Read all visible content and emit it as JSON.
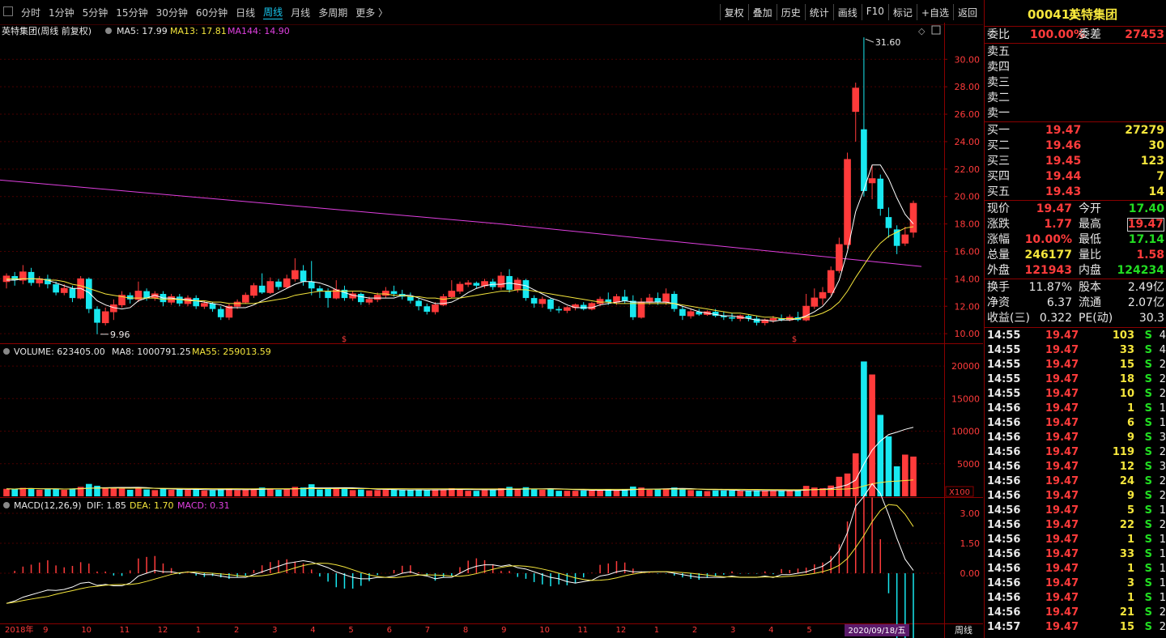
{
  "toolbar": {
    "periods": [
      "分时",
      "1分钟",
      "5分钟",
      "15分钟",
      "30分钟",
      "60分钟",
      "日线",
      "周线",
      "月线",
      "多周期",
      "更多 〉"
    ],
    "active_period": "周线",
    "tools": [
      "复权",
      "叠加",
      "历史",
      "统计",
      "画线",
      "F10",
      "标记",
      "+自选",
      "返回"
    ]
  },
  "chart_header": {
    "title": "英特集团(周线 前复权)",
    "ma5": "MA5: 17.99",
    "ma13": "MA13: 17.81",
    "ma144": "MA144: 14.90",
    "volume": "VOLUME: 623405.00",
    "ma8": "MA8: 1000791.25",
    "ma55": "MA55: 259013.59",
    "macd_name": "MACD(12,26,9)",
    "dif": "DIF: 1.85",
    "dea": "DEA: 1.70",
    "macd": "MACD: 0.31"
  },
  "colors": {
    "up": "#ff3b3b",
    "down": "#18e8f0",
    "ma5": "#ffffff",
    "ma13": "#f5e63c",
    "ma144": "#e040e0"
  },
  "chart_data": [
    {
      "type": "candlestick",
      "title": "英特集团(周线 前复权)",
      "price_ticks": [
        "30.00",
        "28.00",
        "26.00",
        "24.00",
        "22.00",
        "20.00",
        "18.00",
        "16.00",
        "14.00",
        "12.00",
        "10.00"
      ],
      "ylim": [
        9.3,
        32.2
      ],
      "high_label": "31.60",
      "low_label": "9.96",
      "candles": [
        [
          13.8,
          14.2,
          13.3,
          14.4
        ],
        [
          14.2,
          13.9,
          13.5,
          14.5
        ],
        [
          13.9,
          14.5,
          13.6,
          15.0
        ],
        [
          14.5,
          13.7,
          13.5,
          14.8
        ],
        [
          13.7,
          14.0,
          13.4,
          14.2
        ],
        [
          14.0,
          13.6,
          13.3,
          14.3
        ],
        [
          13.6,
          13.0,
          12.8,
          13.8
        ],
        [
          13.0,
          13.3,
          12.8,
          13.6
        ],
        [
          13.3,
          12.6,
          12.3,
          13.5
        ],
        [
          12.6,
          14.0,
          12.5,
          14.2
        ],
        [
          14.0,
          11.8,
          11.5,
          14.1
        ],
        [
          11.8,
          10.8,
          9.96,
          12.0
        ],
        [
          10.8,
          11.6,
          10.6,
          11.9
        ],
        [
          11.6,
          12.1,
          11.0,
          12.5
        ],
        [
          12.1,
          12.8,
          11.9,
          13.1
        ],
        [
          12.8,
          12.5,
          12.2,
          13.0
        ],
        [
          12.5,
          13.1,
          12.3,
          13.8
        ],
        [
          13.1,
          12.6,
          12.4,
          13.3
        ],
        [
          12.6,
          12.9,
          12.4,
          13.1
        ],
        [
          12.9,
          12.3,
          12.0,
          13.1
        ],
        [
          12.3,
          12.7,
          12.1,
          12.9
        ],
        [
          12.7,
          12.2,
          12.0,
          12.9
        ],
        [
          12.2,
          12.6,
          12.0,
          12.8
        ],
        [
          12.6,
          12.0,
          11.8,
          12.8
        ],
        [
          12.0,
          12.2,
          11.8,
          12.4
        ],
        [
          12.2,
          11.8,
          11.6,
          12.3
        ],
        [
          11.8,
          11.2,
          11.0,
          12.0
        ],
        [
          11.2,
          12.0,
          11.0,
          12.2
        ],
        [
          12.0,
          12.3,
          11.8,
          12.5
        ],
        [
          12.3,
          12.8,
          12.2,
          13.0
        ],
        [
          12.8,
          13.5,
          12.6,
          13.7
        ],
        [
          13.5,
          13.0,
          12.9,
          14.4
        ],
        [
          13.0,
          13.8,
          12.9,
          14.1
        ],
        [
          13.8,
          13.4,
          13.2,
          14.0
        ],
        [
          13.4,
          14.0,
          13.3,
          14.3
        ],
        [
          14.0,
          14.6,
          13.8,
          15.5
        ],
        [
          14.6,
          13.8,
          13.5,
          15.0
        ],
        [
          13.8,
          13.3,
          12.8,
          15.3
        ],
        [
          13.3,
          13.1,
          12.6,
          13.5
        ],
        [
          13.1,
          12.6,
          11.9,
          13.3
        ],
        [
          12.6,
          13.2,
          12.5,
          13.9
        ],
        [
          13.2,
          12.6,
          12.4,
          13.5
        ],
        [
          12.6,
          12.9,
          12.4,
          13.1
        ],
        [
          12.9,
          12.3,
          12.1,
          13.0
        ],
        [
          12.3,
          12.5,
          12.1,
          12.7
        ],
        [
          12.5,
          12.8,
          12.3,
          13.0
        ],
        [
          12.8,
          13.1,
          12.6,
          13.4
        ],
        [
          13.1,
          12.9,
          12.7,
          13.5
        ],
        [
          12.9,
          12.7,
          12.5,
          13.2
        ],
        [
          12.7,
          12.4,
          12.2,
          13.0
        ],
        [
          12.4,
          12.0,
          11.7,
          12.6
        ],
        [
          12.0,
          11.6,
          11.4,
          12.2
        ],
        [
          11.6,
          12.1,
          11.4,
          12.3
        ],
        [
          12.1,
          12.7,
          12.0,
          12.9
        ],
        [
          12.7,
          13.1,
          12.6,
          13.9
        ],
        [
          13.1,
          13.6,
          12.9,
          13.8
        ],
        [
          13.6,
          13.7,
          13.4,
          13.9
        ],
        [
          13.7,
          13.5,
          13.3,
          13.8
        ],
        [
          13.5,
          13.8,
          13.3,
          14.0
        ],
        [
          13.8,
          13.4,
          13.2,
          14.0
        ],
        [
          13.4,
          14.2,
          13.2,
          14.5
        ],
        [
          14.2,
          13.2,
          13.0,
          14.7
        ],
        [
          13.2,
          13.9,
          13.0,
          14.1
        ],
        [
          13.9,
          12.6,
          12.4,
          14.0
        ],
        [
          12.6,
          12.2,
          11.9,
          12.8
        ],
        [
          12.2,
          12.5,
          11.9,
          12.7
        ],
        [
          12.5,
          11.8,
          11.6,
          12.6
        ],
        [
          11.8,
          11.7,
          11.5,
          12.0
        ],
        [
          11.7,
          11.9,
          11.5,
          12.0
        ],
        [
          11.9,
          12.1,
          11.7,
          12.2
        ],
        [
          12.1,
          11.8,
          11.7,
          12.3
        ],
        [
          11.8,
          12.2,
          11.7,
          12.3
        ],
        [
          12.2,
          12.5,
          12.0,
          12.7
        ],
        [
          12.5,
          12.3,
          12.1,
          13.0
        ],
        [
          12.3,
          12.7,
          12.1,
          12.9
        ],
        [
          12.7,
          12.4,
          12.2,
          13.2
        ],
        [
          12.4,
          11.2,
          11.0,
          12.8
        ],
        [
          11.2,
          12.3,
          11.1,
          12.6
        ],
        [
          12.3,
          12.6,
          12.1,
          12.9
        ],
        [
          12.6,
          12.3,
          12.1,
          13.0
        ],
        [
          12.3,
          12.9,
          12.1,
          13.3
        ],
        [
          12.9,
          11.8,
          11.6,
          13.1
        ],
        [
          11.8,
          11.3,
          11.0,
          12.0
        ],
        [
          11.3,
          11.6,
          11.1,
          11.8
        ],
        [
          11.6,
          11.4,
          11.3,
          11.8
        ],
        [
          11.4,
          11.6,
          11.3,
          11.7
        ],
        [
          11.6,
          11.3,
          11.2,
          11.8
        ],
        [
          11.3,
          11.2,
          11.0,
          11.6
        ],
        [
          11.2,
          11.1,
          10.9,
          11.5
        ],
        [
          11.1,
          11.3,
          10.9,
          11.4
        ],
        [
          11.3,
          11.1,
          10.9,
          11.4
        ],
        [
          11.1,
          10.8,
          10.6,
          11.3
        ],
        [
          10.8,
          11.0,
          10.6,
          11.1
        ],
        [
          11.0,
          11.1,
          10.8,
          11.3
        ],
        [
          11.1,
          11.0,
          10.9,
          11.4
        ],
        [
          11.0,
          11.2,
          10.9,
          11.4
        ],
        [
          11.2,
          11.0,
          10.9,
          11.6
        ],
        [
          11.0,
          12.0,
          10.9,
          12.9
        ],
        [
          12.0,
          12.6,
          11.8,
          13.3
        ],
        [
          12.6,
          13.0,
          12.1,
          13.4
        ],
        [
          13.0,
          14.6,
          12.8,
          14.9
        ],
        [
          14.6,
          16.5,
          14.4,
          17.0
        ],
        [
          16.5,
          22.7,
          16.2,
          23.2
        ],
        [
          26.2,
          27.9,
          24.0,
          28.3
        ],
        [
          24.9,
          20.4,
          20.0,
          31.6
        ],
        [
          21.0,
          21.3,
          19.8,
          22.3
        ],
        [
          21.3,
          19.1,
          18.6,
          21.6
        ],
        [
          18.5,
          17.7,
          17.0,
          19.2
        ],
        [
          17.6,
          16.4,
          15.8,
          17.9
        ],
        [
          16.6,
          17.2,
          16.4,
          17.8
        ],
        [
          17.4,
          19.5,
          17.0,
          19.7
        ]
      ],
      "ma5": [
        13.9,
        13.9,
        14.0,
        14.0,
        14.0,
        13.9,
        13.7,
        13.5,
        13.3,
        13.3,
        13.0,
        12.4,
        12.1,
        11.9,
        11.8,
        11.9,
        12.4,
        12.6,
        12.8,
        12.6,
        12.6,
        12.5,
        12.5,
        12.4,
        12.3,
        12.2,
        12.1,
        11.9,
        11.9,
        11.9,
        12.1,
        12.4,
        12.7,
        13.0,
        13.3,
        13.6,
        13.8,
        13.8,
        13.7,
        13.5,
        13.2,
        13.0,
        12.8,
        12.7,
        12.6,
        12.6,
        12.6,
        12.6,
        12.8,
        12.8,
        12.6,
        12.4,
        12.2,
        12.2,
        12.3,
        12.6,
        13.0,
        13.3,
        13.5,
        13.6,
        13.6,
        13.7,
        13.6,
        13.5,
        13.2,
        12.9,
        12.6,
        12.4,
        12.1,
        11.9,
        11.9,
        11.9,
        12.1,
        12.2,
        12.3,
        12.4,
        12.3,
        12.3,
        12.3,
        12.3,
        12.3,
        12.2,
        12.0,
        11.8,
        11.6,
        11.5,
        11.4,
        11.3,
        11.3,
        11.2,
        11.1,
        11.0,
        11.0,
        10.9,
        11.0,
        11.0,
        11.1,
        11.3,
        11.6,
        12.0,
        12.7,
        13.9,
        16.0,
        18.9,
        20.5,
        22.3,
        22.3,
        21.3,
        19.9,
        18.7,
        18.0
      ],
      "ma13": [
        14.0,
        14.0,
        14.0,
        14.0,
        14.0,
        13.9,
        13.9,
        13.8,
        13.6,
        13.5,
        13.3,
        13.1,
        12.9,
        12.8,
        12.7,
        12.6,
        12.6,
        12.6,
        12.6,
        12.5,
        12.5,
        12.5,
        12.4,
        12.4,
        12.4,
        12.3,
        12.3,
        12.2,
        12.2,
        12.2,
        12.2,
        12.3,
        12.4,
        12.5,
        12.6,
        12.8,
        12.9,
        13.0,
        13.1,
        13.1,
        13.1,
        13.1,
        13.1,
        13.1,
        13.0,
        12.9,
        12.9,
        12.8,
        12.8,
        12.7,
        12.7,
        12.6,
        12.6,
        12.5,
        12.6,
        12.6,
        12.7,
        12.8,
        12.9,
        13.0,
        13.1,
        13.1,
        13.2,
        13.2,
        13.1,
        13.0,
        12.9,
        12.8,
        12.7,
        12.6,
        12.5,
        12.4,
        12.3,
        12.3,
        12.2,
        12.2,
        12.2,
        12.2,
        12.2,
        12.2,
        12.2,
        12.2,
        12.1,
        12.0,
        11.9,
        11.8,
        11.7,
        11.6,
        11.5,
        11.5,
        11.4,
        11.3,
        11.2,
        11.2,
        11.1,
        11.1,
        11.1,
        11.2,
        11.3,
        11.5,
        11.8,
        12.3,
        13.1,
        14.1,
        15.0,
        15.9,
        16.6,
        17.1,
        17.4,
        17.7,
        17.8
      ],
      "ma144": [
        21.2,
        14.9
      ],
      "volume_ticks": [
        "20000",
        "15000",
        "10000",
        "5000"
      ],
      "volume_unit": "X100",
      "macd_ticks": [
        "3.00",
        "1.50",
        "0.00"
      ],
      "x_labels": [
        "2018年",
        "9",
        "10",
        "11",
        "12",
        "1",
        "2",
        "3",
        "4",
        "5",
        "6",
        "7",
        "8",
        "9",
        "10",
        "11",
        "12",
        "1",
        "2",
        "3",
        "4",
        "5",
        "6",
        "7"
      ],
      "cursor_date": "2020/09/18/五",
      "period_label": "周线"
    }
  ],
  "panel": {
    "code": "000411",
    "name": "英特集团",
    "weibi_label": "委比",
    "weibi": "100.00%",
    "weicha_label": "委差",
    "weicha": "27453",
    "asks": [
      "卖五",
      "卖四",
      "卖三",
      "卖二",
      "卖一"
    ],
    "bids": [
      {
        "label": "买一",
        "price": "19.47",
        "vol": "27279"
      },
      {
        "label": "买二",
        "price": "19.46",
        "vol": "30"
      },
      {
        "label": "买三",
        "price": "19.45",
        "vol": "123"
      },
      {
        "label": "买四",
        "price": "19.44",
        "vol": "7"
      },
      {
        "label": "买五",
        "price": "19.43",
        "vol": "14"
      }
    ],
    "quote": [
      {
        "l1": "现价",
        "v1": "19.47",
        "c1": "red",
        "l2": "今开",
        "v2": "17.40",
        "c2": "green"
      },
      {
        "l1": "涨跌",
        "v1": "1.77",
        "c1": "red",
        "l2": "最高",
        "v2": "19.47",
        "c2": "red",
        "box": true
      },
      {
        "l1": "涨幅",
        "v1": "10.00%",
        "c1": "red",
        "l2": "最低",
        "v2": "17.14",
        "c2": "green"
      },
      {
        "l1": "总量",
        "v1": "246177",
        "c1": "yellow",
        "l2": "量比",
        "v2": "1.58",
        "c2": "red"
      },
      {
        "l1": "外盘",
        "v1": "121943",
        "c1": "red",
        "l2": "内盘",
        "v2": "124234",
        "c2": "green"
      }
    ],
    "stats": [
      {
        "l1": "换手",
        "v1": "11.87%",
        "l2": "股本",
        "v2": "2.49亿"
      },
      {
        "l1": "净资",
        "v1": "6.37",
        "l2": "流通",
        "v2": "2.07亿"
      },
      {
        "l1": "收益(三)",
        "v1": "0.322",
        "l2": "PE(动)",
        "v2": "30.3"
      }
    ],
    "ticks": [
      [
        "14:55",
        "19.47",
        "103",
        "S",
        "4"
      ],
      [
        "14:55",
        "19.47",
        "33",
        "S",
        "4"
      ],
      [
        "14:55",
        "19.47",
        "15",
        "S",
        "2"
      ],
      [
        "14:55",
        "19.47",
        "18",
        "S",
        "2"
      ],
      [
        "14:55",
        "19.47",
        "10",
        "S",
        "2"
      ],
      [
        "14:56",
        "19.47",
        "1",
        "S",
        "1"
      ],
      [
        "14:56",
        "19.47",
        "6",
        "S",
        "1"
      ],
      [
        "14:56",
        "19.47",
        "9",
        "S",
        "3"
      ],
      [
        "14:56",
        "19.47",
        "119",
        "S",
        "2"
      ],
      [
        "14:56",
        "19.47",
        "12",
        "S",
        "3"
      ],
      [
        "14:56",
        "19.47",
        "24",
        "S",
        "2"
      ],
      [
        "14:56",
        "19.47",
        "9",
        "S",
        "2"
      ],
      [
        "14:56",
        "19.47",
        "5",
        "S",
        "1"
      ],
      [
        "14:56",
        "19.47",
        "22",
        "S",
        "2"
      ],
      [
        "14:56",
        "19.47",
        "1",
        "S",
        "1"
      ],
      [
        "14:56",
        "19.47",
        "33",
        "S",
        "1"
      ],
      [
        "14:56",
        "19.47",
        "1",
        "S",
        "1"
      ],
      [
        "14:56",
        "19.47",
        "3",
        "S",
        "1"
      ],
      [
        "14:56",
        "19.47",
        "1",
        "S",
        "1"
      ],
      [
        "14:56",
        "19.47",
        "21",
        "S",
        "2"
      ],
      [
        "14:57",
        "19.47",
        "15",
        "S",
        "2"
      ]
    ]
  }
}
